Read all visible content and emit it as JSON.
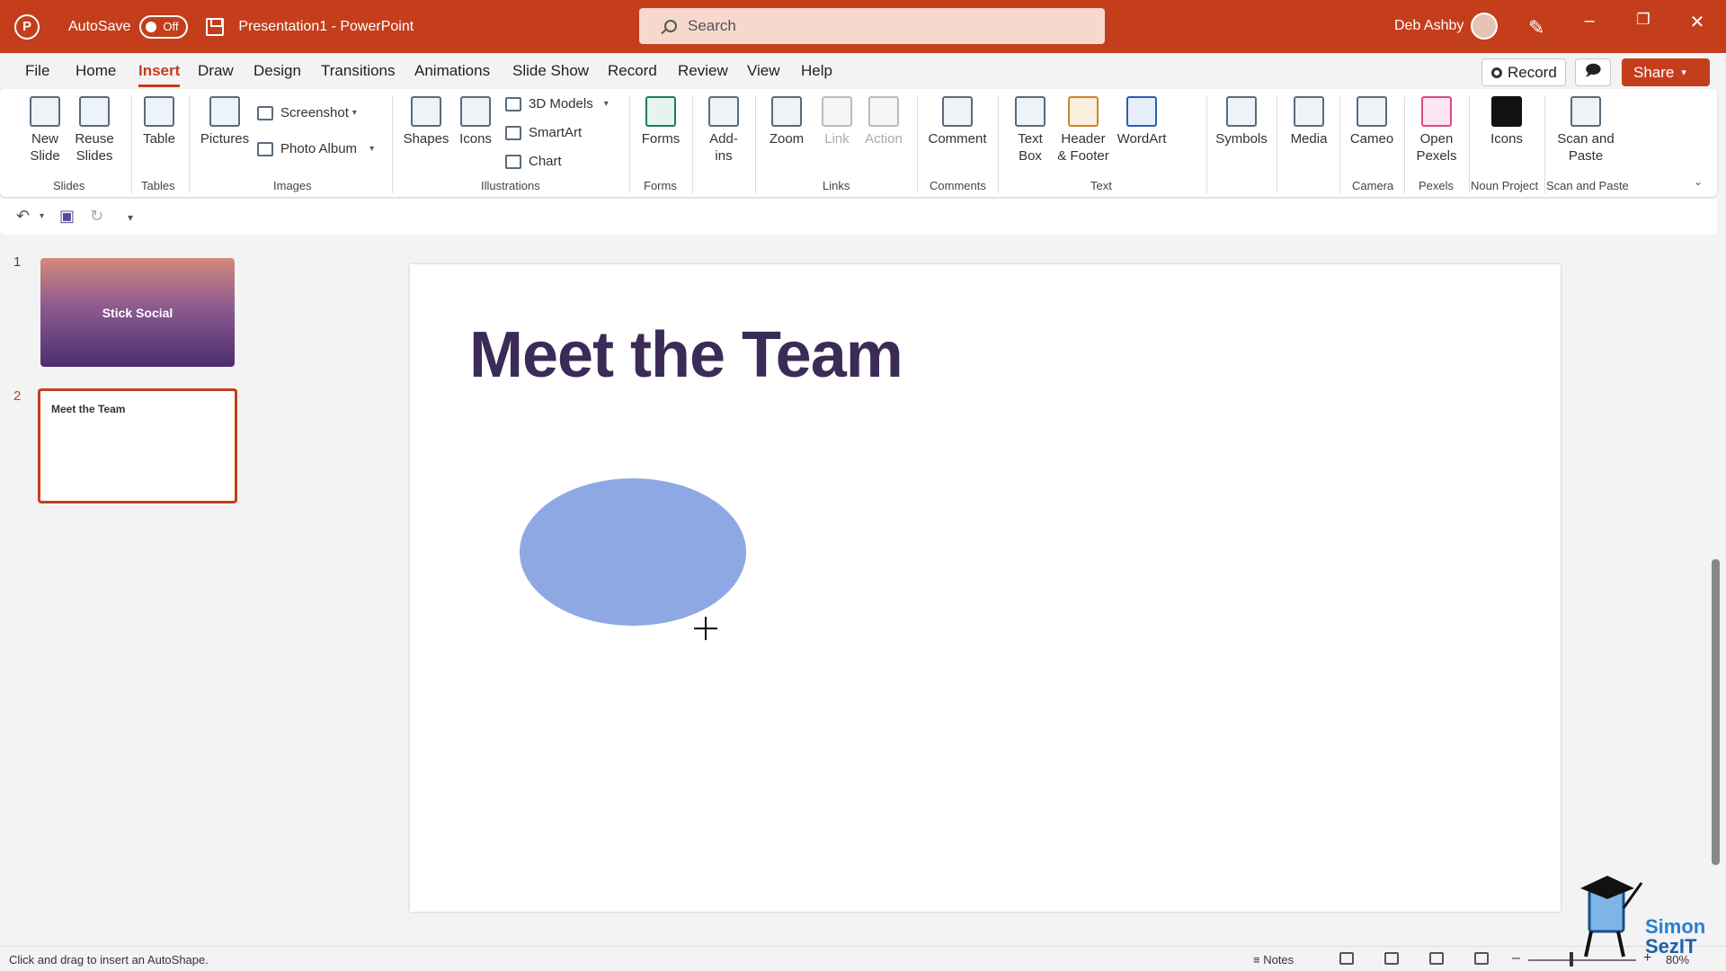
{
  "titlebar": {
    "autosave_label": "AutoSave",
    "autosave_state": "Off",
    "document": "Presentation1  -  PowerPoint",
    "search_placeholder": "Search",
    "user": "Deb Ashby"
  },
  "tabs": [
    "File",
    "Home",
    "Insert",
    "Draw",
    "Design",
    "Transitions",
    "Animations",
    "Slide Show",
    "Record",
    "Review",
    "View",
    "Help"
  ],
  "active_tab": "Insert",
  "header_buttons": {
    "record": "Record",
    "share": "Share"
  },
  "ribbon": {
    "slides": {
      "new_slide": "New Slide",
      "reuse_slides": "Reuse Slides",
      "group": "Slides"
    },
    "tables": {
      "table": "Table",
      "group": "Tables"
    },
    "images": {
      "pictures": "Pictures",
      "screenshot": "Screenshot",
      "photo_album": "Photo Album",
      "group": "Images"
    },
    "illustrations": {
      "shapes": "Shapes",
      "icons": "Icons",
      "models": "3D Models",
      "smartart": "SmartArt",
      "chart": "Chart",
      "group": "Illustrations"
    },
    "forms": {
      "forms": "Forms",
      "group": "Forms"
    },
    "addins": {
      "addins": "Add-ins"
    },
    "links": {
      "zoom": "Zoom",
      "link": "Link",
      "action": "Action",
      "group": "Links"
    },
    "comments": {
      "comment": "Comment",
      "group": "Comments"
    },
    "text": {
      "text_box": "Text Box",
      "header_footer": "Header & Footer",
      "wordart": "WordArt",
      "group": "Text"
    },
    "symbols": {
      "symbols": "Symbols"
    },
    "media": {
      "media": "Media"
    },
    "camera": {
      "cameo": "Cameo",
      "group": "Camera"
    },
    "pexels": {
      "open_pexels": "Open Pexels",
      "group": "Pexels"
    },
    "noun": {
      "icons": "Icons",
      "group": "Noun Project"
    },
    "scan": {
      "scan_paste": "Scan and Paste",
      "group": "Scan and Paste"
    }
  },
  "thumbnails": [
    {
      "num": "1",
      "title": "Stick Social"
    },
    {
      "num": "2",
      "title": "Meet the Team"
    }
  ],
  "slide": {
    "title": "Meet the Team",
    "shape_color": "#8ea8e3"
  },
  "status": {
    "message": "Click and drag to insert an AutoShape.",
    "notes": "Notes",
    "zoom": "80%"
  },
  "watermark": {
    "line1": "Simon",
    "line2": "SezIT"
  }
}
